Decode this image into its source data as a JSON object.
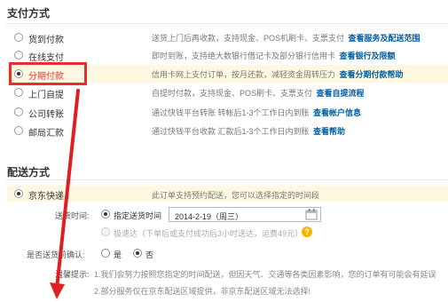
{
  "payment": {
    "title": "支付方式",
    "options": [
      {
        "name": "货到付款",
        "desc": "送货上门后再收款，支持现金、POS机刷卡、支票支付",
        "link": "查看服务及配送范围",
        "checked": false
      },
      {
        "name": "在线支付",
        "desc": "即时到账，支持绝大数银行借记卡及部分银行信用卡",
        "link": "查看银行及限额",
        "checked": false
      },
      {
        "name": "分期付款",
        "desc": "信用卡网上支付订单，按月还款，减轻资金周转压力",
        "link": "查看分期付款帮助",
        "checked": true
      },
      {
        "name": "上门自提",
        "desc": "自提时付款，支持现金、POS刷卡、支票支付",
        "link": "查看自提流程",
        "checked": false
      },
      {
        "name": "公司转账",
        "desc": "通过快钱平台转账 转帐后1-3个工作日内到账",
        "link": "查看帐户信息",
        "checked": false
      },
      {
        "name": "邮局汇款",
        "desc": "通过快钱平台收款 汇款后1-3个工作日内到账",
        "link": "查看帮助",
        "checked": false
      }
    ]
  },
  "shipping": {
    "title": "配送方式",
    "method": {
      "name": "京东快递",
      "desc": "此订单支持预约配送，您可以选择指定的时间段"
    },
    "time_label": "送货时间:",
    "specified_label": "指定送货时间",
    "date_value": "2014-2-19（周三）",
    "express_label": "极速达（下单后或支付成功后3小时送达，运费49元）",
    "confirm_label": "是否送货前确认:",
    "yes_label": "是",
    "no_label": "否",
    "tips_label": "温馨提示:",
    "tip1": "1.我们会努力按照您指定的时间配送，但因天气、交通等各类因素影响，您的订单有可能会有延误",
    "tip2": "2.部分服务仅在京东配送区域提供，非京东配送区域无法选择!"
  },
  "icons": {
    "calendar": "calendar-icon",
    "help": "help-icon",
    "annotation": "red-arrow-annotation"
  },
  "colors": {
    "highlight_border": "#e03030",
    "link": "#005ea7",
    "selected_bg": "#fff8e1",
    "arrow": "#e02020"
  }
}
